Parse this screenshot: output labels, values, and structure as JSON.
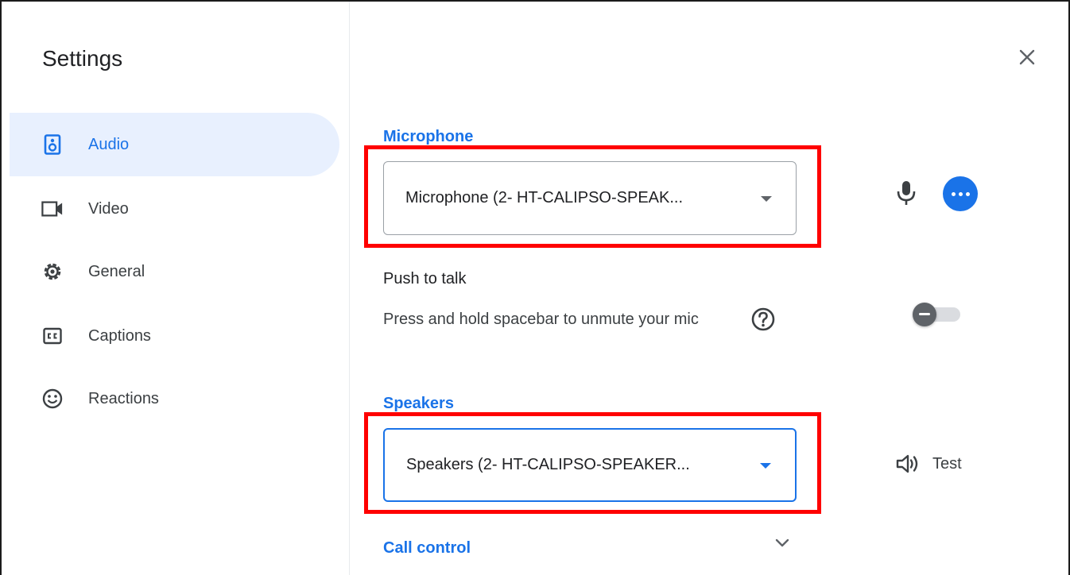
{
  "dialog": {
    "title": "Settings",
    "close_icon": "close-icon"
  },
  "sidebar": {
    "items": [
      {
        "label": "Audio",
        "icon": "speaker-device-icon",
        "active": true
      },
      {
        "label": "Video",
        "icon": "video-camera-icon",
        "active": false
      },
      {
        "label": "General",
        "icon": "gear-icon",
        "active": false
      },
      {
        "label": "Captions",
        "icon": "closed-captions-icon",
        "active": false
      },
      {
        "label": "Reactions",
        "icon": "smiley-icon",
        "active": false
      }
    ]
  },
  "audio": {
    "microphone": {
      "label": "Microphone",
      "selected": "Microphone (2- HT-CALIPSO-SPEAK...",
      "icons": [
        "microphone-icon",
        "more-options-icon"
      ]
    },
    "push_to_talk": {
      "title": "Push to talk",
      "description": "Press and hold spacebar to unmute your mic",
      "enabled": false,
      "icon": "help-icon"
    },
    "speakers": {
      "label": "Speakers",
      "selected": "Speakers (2- HT-CALIPSO-SPEAKER...",
      "test_label": "Test",
      "icon": "speaker-volume-icon"
    },
    "call_control": {
      "label": "Call control",
      "icon": "chevron-down-icon"
    }
  },
  "colors": {
    "accent": "#1a73e8",
    "active_bg": "#e8f0fe",
    "highlight_box": "#ff0000"
  }
}
